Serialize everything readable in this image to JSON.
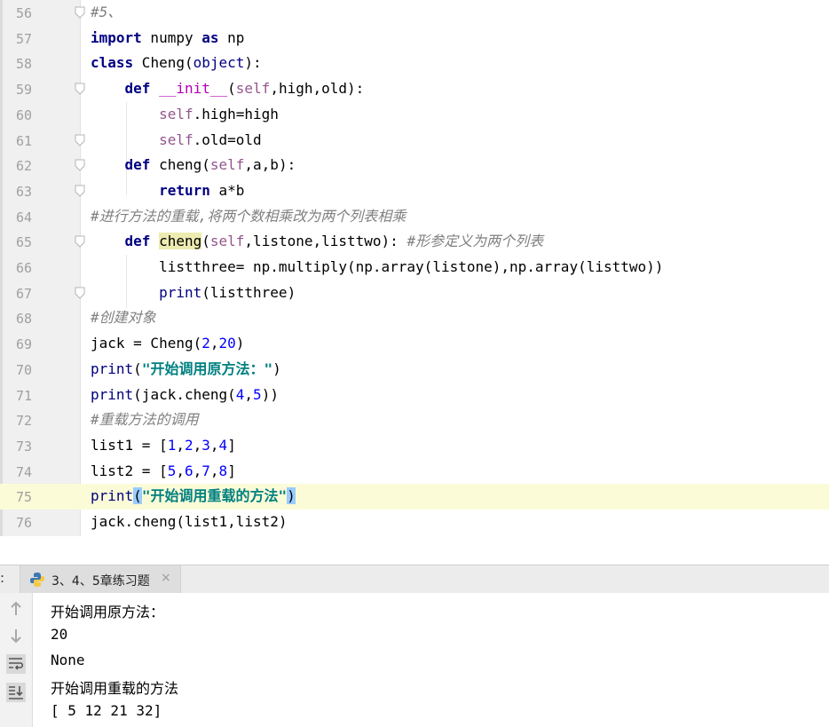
{
  "editor": {
    "lines": [
      {
        "num": "56",
        "seg": [
          {
            "t": "#5、",
            "c": "cmt"
          }
        ]
      },
      {
        "num": "57",
        "seg": [
          {
            "t": "import",
            "c": "kw"
          },
          {
            "t": " numpy "
          },
          {
            "t": "as",
            "c": "kw"
          },
          {
            "t": " np"
          }
        ]
      },
      {
        "num": "58",
        "seg": [
          {
            "t": "class",
            "c": "kw"
          },
          {
            "t": " Cheng("
          },
          {
            "t": "object",
            "c": "builtin"
          },
          {
            "t": "):"
          }
        ]
      },
      {
        "num": "59",
        "seg": [
          {
            "t": "    "
          },
          {
            "t": "def",
            "c": "kw"
          },
          {
            "t": " "
          },
          {
            "t": "__init__",
            "c": "magic"
          },
          {
            "t": "("
          },
          {
            "t": "self",
            "c": "self"
          },
          {
            "t": ",high,old):"
          }
        ]
      },
      {
        "num": "60",
        "seg": [
          {
            "t": "        "
          },
          {
            "t": "self",
            "c": "self"
          },
          {
            "t": ".high=high"
          }
        ]
      },
      {
        "num": "61",
        "seg": [
          {
            "t": "        "
          },
          {
            "t": "self",
            "c": "self"
          },
          {
            "t": ".old=old"
          }
        ]
      },
      {
        "num": "62",
        "seg": [
          {
            "t": "    "
          },
          {
            "t": "def",
            "c": "kw"
          },
          {
            "t": " cheng("
          },
          {
            "t": "self",
            "c": "self"
          },
          {
            "t": ",a,b):"
          }
        ]
      },
      {
        "num": "63",
        "seg": [
          {
            "t": "        "
          },
          {
            "t": "return",
            "c": "kw"
          },
          {
            "t": " a*b"
          }
        ]
      },
      {
        "num": "64",
        "seg": [
          {
            "t": "#进行方法的重载,将两个数相乘改为两个列表相乘",
            "c": "cmt"
          }
        ]
      },
      {
        "num": "65",
        "seg": [
          {
            "t": "    "
          },
          {
            "t": "def",
            "c": "kw"
          },
          {
            "t": " "
          },
          {
            "t": "cheng",
            "c": "hl"
          },
          {
            "t": "("
          },
          {
            "t": "self",
            "c": "self"
          },
          {
            "t": ",listone,listtwo): "
          },
          {
            "t": "#形参定义为两个列表",
            "c": "cmt"
          }
        ]
      },
      {
        "num": "66",
        "seg": [
          {
            "t": "        listthree= np.multiply(np.array(listone),np.array(listtwo))"
          }
        ]
      },
      {
        "num": "67",
        "seg": [
          {
            "t": "        "
          },
          {
            "t": "print",
            "c": "builtin"
          },
          {
            "t": "(listthree)"
          }
        ]
      },
      {
        "num": "68",
        "seg": [
          {
            "t": "#创建对象",
            "c": "cmt"
          }
        ]
      },
      {
        "num": "69",
        "seg": [
          {
            "t": "jack = Cheng("
          },
          {
            "t": "2",
            "c": "num"
          },
          {
            "t": ","
          },
          {
            "t": "20",
            "c": "num"
          },
          {
            "t": ")"
          }
        ]
      },
      {
        "num": "70",
        "seg": [
          {
            "t": "print",
            "c": "builtin"
          },
          {
            "t": "("
          },
          {
            "t": "\"开始调用原方法：\"",
            "c": "str"
          },
          {
            "t": ")"
          }
        ]
      },
      {
        "num": "71",
        "seg": [
          {
            "t": "print",
            "c": "builtin"
          },
          {
            "t": "(jack.cheng("
          },
          {
            "t": "4",
            "c": "num"
          },
          {
            "t": ","
          },
          {
            "t": "5",
            "c": "num"
          },
          {
            "t": "))"
          }
        ]
      },
      {
        "num": "72",
        "seg": [
          {
            "t": "#重载方法的调用",
            "c": "cmt"
          }
        ]
      },
      {
        "num": "73",
        "seg": [
          {
            "t": "list1 = ["
          },
          {
            "t": "1",
            "c": "num"
          },
          {
            "t": ","
          },
          {
            "t": "2",
            "c": "num"
          },
          {
            "t": ","
          },
          {
            "t": "3",
            "c": "num"
          },
          {
            "t": ","
          },
          {
            "t": "4",
            "c": "num"
          },
          {
            "t": "]"
          }
        ]
      },
      {
        "num": "74",
        "seg": [
          {
            "t": "list2 = ["
          },
          {
            "t": "5",
            "c": "num"
          },
          {
            "t": ","
          },
          {
            "t": "6",
            "c": "num"
          },
          {
            "t": ","
          },
          {
            "t": "7",
            "c": "num"
          },
          {
            "t": ","
          },
          {
            "t": "8",
            "c": "num"
          },
          {
            "t": "]"
          }
        ]
      },
      {
        "num": "75",
        "current": true,
        "seg": [
          {
            "t": "print",
            "c": "builtin"
          },
          {
            "t": "(",
            "c": "br"
          },
          {
            "t": "\"开始调用重载的方法\"",
            "c": "str"
          },
          {
            "t": ")",
            "c": "br"
          }
        ]
      },
      {
        "num": "76",
        "seg": [
          {
            "t": "jack.cheng(list1,list2)"
          }
        ]
      }
    ],
    "fold_lines": [
      "56",
      "59",
      "61",
      "62",
      "63",
      "65",
      "67"
    ]
  },
  "run": {
    "tab_label": "3、4、5章练习题",
    "close_glyph": "×",
    "tools": [
      "up-arrow-icon",
      "down-arrow-icon",
      "soft-wrap-icon",
      "scroll-to-end-icon"
    ],
    "output": [
      "开始调用原方法：",
      "20",
      "None",
      "开始调用重载的方法",
      "[ 5 12 21 32]"
    ]
  },
  "colors": {
    "keyword": "#000080",
    "self": "#94558d",
    "number": "#0000ff",
    "string": "#008080",
    "comment": "#808080",
    "current_line": "#fbfbd8"
  }
}
